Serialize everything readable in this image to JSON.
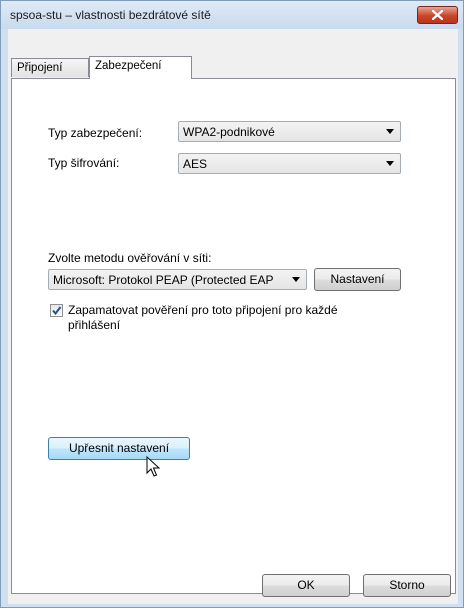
{
  "window": {
    "title": "spsoa-stu – vlastnosti bezdrátové sítě",
    "close_icon": "close-icon"
  },
  "tabs": [
    {
      "label": "Připojení",
      "active": false
    },
    {
      "label": "Zabezpečení",
      "active": true
    }
  ],
  "security": {
    "type_label": "Typ zabezpečení:",
    "type_value": "WPA2-podnikové",
    "encryption_label": "Typ šifrování:",
    "encryption_value": "AES",
    "method_label": "Zvolte metodu ověřování v síti:",
    "method_value": "Microsoft: Protokol PEAP (Protected EAP",
    "settings_button": "Nastavení",
    "remember_checkbox": {
      "checked": true,
      "label_line1": "Zapamatovat pověření pro toto připojení pro každé",
      "label_line2": "přihlášení"
    },
    "advanced_button": "Upřesnit nastavení"
  },
  "footer": {
    "ok_button": "OK",
    "cancel_button": "Storno"
  },
  "colors": {
    "window_frame": "#cfe0f1",
    "close_button": "#c9462a",
    "focused_button": "#a7d9f5"
  }
}
